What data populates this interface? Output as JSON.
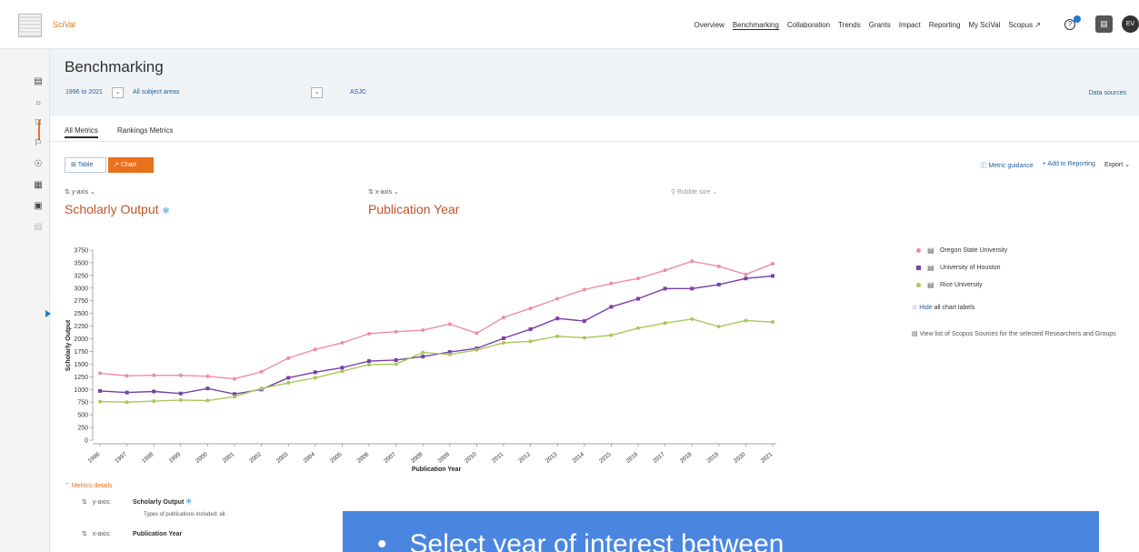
{
  "app": {
    "brand": "SciVal"
  },
  "topnav": [
    "Overview",
    "Benchmarking",
    "Collaboration",
    "Trends",
    "Grants",
    "Impact",
    "Reporting",
    "My SciVal",
    "Scopus ↗"
  ],
  "topnav_active": "Benchmarking",
  "user_initials": "EV",
  "help_icon": "?",
  "rail_icons": [
    "institution-icon",
    "person-icon",
    "document-icon",
    "flag-icon",
    "target-icon",
    "grid-icon",
    "page-icon",
    "building-icon"
  ],
  "page": {
    "title": "Benchmarking",
    "year_range": "1996 to 2021",
    "subject": "All subject areas",
    "classification": "ASJC",
    "data_sources": "Data sources"
  },
  "tabs": [
    "All Metrics",
    "Rankings Metrics"
  ],
  "view": {
    "table_label": "Table",
    "chart_label": "Chart",
    "active": "Chart"
  },
  "actions": {
    "guidance": "Metric guidance",
    "add_reporting": "Add to Reporting",
    "export": "Export"
  },
  "axes": {
    "y_selector": "y-axis",
    "x_selector": "x-axis",
    "bubble_selector": "Bubble size",
    "y_metric": "Scholarly Output",
    "x_metric": "Publication Year"
  },
  "chart_data": {
    "type": "line",
    "xlabel": "Publication Year",
    "ylabel": "Scholarly Output",
    "ylim": [
      0,
      3750
    ],
    "yticks": [
      0,
      250,
      500,
      750,
      1000,
      1250,
      1500,
      1750,
      2000,
      2250,
      2500,
      2750,
      3000,
      3250,
      3500,
      3750
    ],
    "categories": [
      "1996",
      "1997",
      "1998",
      "1999",
      "2000",
      "2001",
      "2002",
      "2003",
      "2004",
      "2005",
      "2006",
      "2007",
      "2008",
      "2009",
      "2010",
      "2011",
      "2012",
      "2013",
      "2014",
      "2015",
      "2016",
      "2017",
      "2018",
      "2019",
      "2020",
      "2021"
    ],
    "series": [
      {
        "name": "Oregon State University",
        "color": "#ee8d9e",
        "marker": "circle",
        "values": [
          1320,
          1270,
          1280,
          1280,
          1260,
          1210,
          1350,
          1620,
          1790,
          1920,
          2100,
          2140,
          2170,
          2290,
          2110,
          2420,
          2600,
          2790,
          2970,
          3090,
          3190,
          3350,
          3530,
          3430,
          3270,
          3480
        ]
      },
      {
        "name": "University of Houston",
        "color": "#7a3fa8",
        "marker": "square",
        "values": [
          970,
          940,
          960,
          920,
          1020,
          910,
          1000,
          1230,
          1340,
          1430,
          1560,
          1580,
          1650,
          1740,
          1810,
          2010,
          2190,
          2400,
          2350,
          2630,
          2790,
          2990,
          2990,
          3070,
          3190,
          3240
        ]
      },
      {
        "name": "Rice University",
        "color": "#a8c85a",
        "marker": "circle",
        "values": [
          760,
          750,
          770,
          790,
          780,
          860,
          1020,
          1130,
          1230,
          1360,
          1490,
          1500,
          1730,
          1690,
          1780,
          1920,
          1950,
          2050,
          2020,
          2070,
          2210,
          2310,
          2390,
          2240,
          2360,
          2330
        ]
      }
    ],
    "legend_position": "right",
    "grid": false
  },
  "legend_extra": {
    "hide": "Hide",
    "hide_suffix": "all chart labels",
    "view_list": "View list of Scopus Sources for the selected Researchers and Groups"
  },
  "metrics_details": {
    "toggle": "Metrics details",
    "y_label": "y-axis:",
    "y_value": "Scholarly Output",
    "y_note": "Types of publications included: all.",
    "x_label": "x-axis:",
    "x_value": "Publication Year"
  },
  "callout": {
    "text": "Select year of interest between"
  }
}
